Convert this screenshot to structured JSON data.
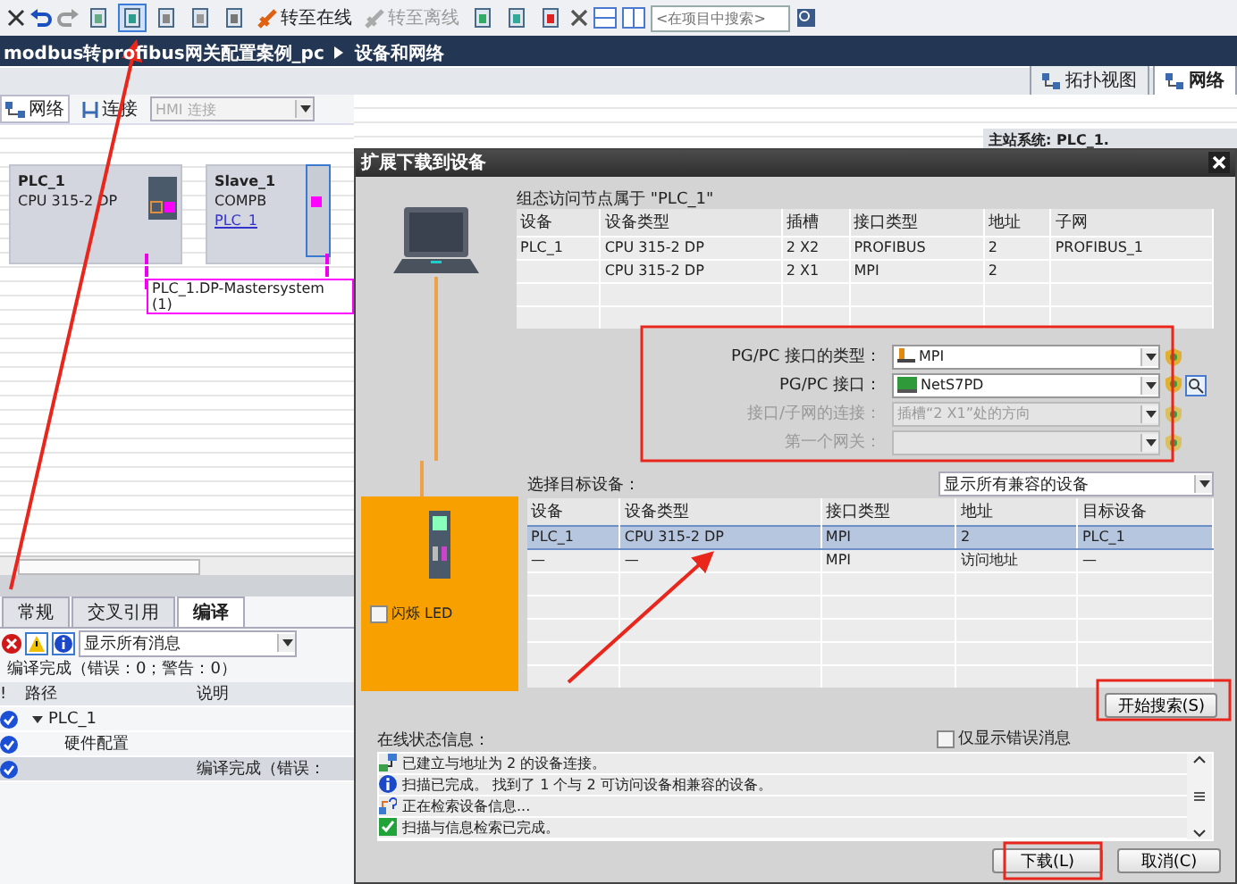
{
  "toolbar": {
    "online_button": {
      "label": "转至在线",
      "disabled": false
    },
    "offline_button": {
      "label": "转至离线",
      "disabled": true
    },
    "search": {
      "placeholder": "<在项目中搜索>"
    }
  },
  "breadcrumb": [
    "modbus转profibus网关配置案例_pc",
    "设备和网络"
  ],
  "view_tabs": [
    {
      "label": "拓扑视图",
      "selected": false
    },
    {
      "label": "网络",
      "selected": true
    }
  ],
  "network_toolbar": {
    "network_button": "网络",
    "connections_button": "连接",
    "connection_type": {
      "value": "HMI 连接",
      "disabled": true
    }
  },
  "master_system": "主站系统: PLC_1.",
  "devices": [
    {
      "name": "PLC_1",
      "type": "CPU 315-2 DP"
    },
    {
      "name": "Slave_1",
      "type": "COMPB",
      "link": "PLC_1"
    }
  ],
  "network_label": "PLC_1.DP-Mastersystem (1)",
  "inspector": {
    "tabs": [
      {
        "label": "常规",
        "selected": false
      },
      {
        "label": "交叉引用",
        "selected": false
      },
      {
        "label": "编译",
        "selected": true
      }
    ],
    "filter": "显示所有消息",
    "summary": "编译完成（错误：0；警告：0）",
    "columns": [
      "!",
      "路径",
      "说明"
    ],
    "rows": [
      {
        "path": "PLC_1",
        "expanded": true,
        "selected": false,
        "children": [
          {
            "path": "硬件配置",
            "selected": false
          },
          {
            "description": "编译完成（错误：",
            "selected": true
          }
        ]
      }
    ]
  },
  "dialog": {
    "title": "扩展下载到设备",
    "access_node_label": "组态访问节点属于 \"PLC_1\"",
    "node_columns": [
      "设备",
      "设备类型",
      "插槽",
      "接口类型",
      "地址",
      "子网"
    ],
    "node_rows": [
      {
        "device": "PLC_1",
        "type": "CPU 315-2 DP",
        "slot": "2 X2",
        "interface": "PROFIBUS",
        "address": "2",
        "subnet": "PROFIBUS_1"
      },
      {
        "type": "CPU 315-2 DP",
        "slot": "2 X1",
        "interface": "MPI",
        "address": "2"
      }
    ],
    "settings": [
      {
        "label": "PG/PC 接口的类型：",
        "value": "MPI",
        "kind": "mpi",
        "disabled": false
      },
      {
        "label": "PG/PC 接口：",
        "value": "NetS7PD",
        "kind": "adapter",
        "disabled": false
      },
      {
        "label": "接口/子网的连接：",
        "value": "插槽“2 X1”处的方向",
        "kind": "plain",
        "disabled": true
      },
      {
        "label": "第一个网关：",
        "kind": "plain",
        "disabled": true
      }
    ],
    "target_label": "选择目标设备：",
    "target_filter": "显示所有兼容的设备",
    "target_columns": [
      "设备",
      "设备类型",
      "接口类型",
      "地址",
      "目标设备"
    ],
    "target_rows": [
      {
        "device": "PLC_1",
        "type": "CPU 315-2 DP",
        "interface": "MPI",
        "address": "2",
        "target": "PLC_1",
        "selected": true
      },
      {
        "device": "—",
        "type": "—",
        "interface": "MPI",
        "address": "访问地址",
        "target": "—",
        "selected": false
      }
    ],
    "flash_led": {
      "label": "闪烁 LED",
      "checked": false
    },
    "search_button": "开始搜索(S)",
    "status_label": "在线状态信息：",
    "errors_only": {
      "label": "仅显示错误消息",
      "checked": false
    },
    "messages": [
      {
        "kind": "connected",
        "text": "已建立与地址为 2 的设备连接。"
      },
      {
        "kind": "info",
        "text": "扫描已完成。 找到了 1 个与 2 可访问设备相兼容的设备。"
      },
      {
        "kind": "searching",
        "text": "正在检索设备信息..."
      },
      {
        "kind": "success",
        "text": "扫描与信息检索已完成。"
      }
    ],
    "buttons": [
      {
        "label": "下载(L)",
        "kind": "primary"
      },
      {
        "label": "取消(C)",
        "kind": "cancel"
      }
    ]
  }
}
